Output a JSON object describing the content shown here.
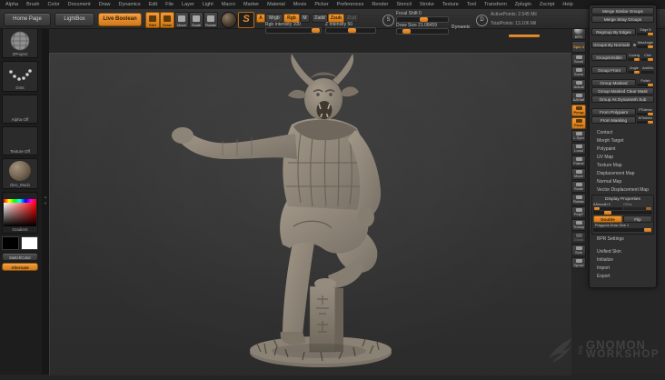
{
  "menubar": {
    "items": [
      "Alpha",
      "Brush",
      "Color",
      "Document",
      "Draw",
      "Dynamics",
      "Edit",
      "File",
      "Layer",
      "Light",
      "Macro",
      "Marker",
      "Material",
      "Movie",
      "Picker",
      "Preferences",
      "Render",
      "Stencil",
      "Stroke",
      "Texture",
      "Tool",
      "Transform",
      "Zplugin",
      "Zscript",
      "Help"
    ]
  },
  "toolbar": {
    "home_page": "Home Page",
    "lightbox": "LightBox",
    "live_boolean": "Live Boolean",
    "edit": "Edit",
    "draw": "Draw",
    "move": "Move",
    "scale": "Scale",
    "rotate": "Rotate",
    "brush_initial": "S",
    "a_badge": "A",
    "mrgb": "Mrgb",
    "rgb": "Rgb",
    "m": "M",
    "zadd": "Zadd",
    "zsub": "Zsub",
    "zcut": "Zcut",
    "rgb_intensity": "Rgb Intensity 100",
    "z_intensity": "Z Intensity 50",
    "stroke_circle": "S",
    "depth_circle": "D",
    "focal_shift": "Focal Shift 0",
    "draw_size": "Draw Size 21.08459",
    "dynamic": "Dynamic",
    "active_points": "ActivePoints: 2.545 Mil",
    "total_points": "TotalPoints: 13.106 Mil"
  },
  "left_tray": {
    "brush_label": "ZProject",
    "stroke_label": "Dots",
    "alpha_label": "Alpha Off",
    "texture_label": "Texture Off",
    "material_label": "zbro_Mud1",
    "gradient_label": "Gradient",
    "switch_color": "SwitchColor",
    "alternate": "Alternate"
  },
  "right_shelf": {
    "items": [
      "BPR",
      "Spix 3",
      "Scroll",
      "Zoom",
      "Actual",
      "AAHalf",
      "Persp",
      "Floor",
      "L.Sym",
      "Local",
      "Frame",
      "Move",
      "Scale",
      "Rotate",
      "PolyF",
      "Transp",
      "Ghost",
      "Solo",
      "Xpose"
    ]
  },
  "tool_panel": {
    "merge_similar": "Merge Similar Groups",
    "merge_stray": "Merge Stray Groups",
    "regroup_by_edges": "Regroup By Edges",
    "edge_slider": "Edge 5",
    "groups_by_normals": "Groups By Normals",
    "max_angle_slider": "MaxAngle",
    "groups_visible": "GroupsVisible",
    "coverage_slider": "Coverg",
    "cluster_slider": "Clstr",
    "group_front": "Group Front",
    "angle_slider": "Angle",
    "addvis_slider": "AddVis",
    "group_masked": "Group Masked",
    "polish_slider": "Polish",
    "group_masked_clear": "Group Masked Clear Mask",
    "group_dynamesh": "Group As Dynamesh Sub",
    "from_polypaint": "From Polypaint",
    "ptolernc_slider": "PTolernc",
    "from_masking": "From Masking",
    "mtolernc_slider": "MTolernc",
    "sections": [
      "Contact",
      "Morph Target",
      "Polypaint",
      "UV Map",
      "Texture Map",
      "Displacement Map",
      "Normal Map",
      "Vector Displacement Map"
    ],
    "display_properties": "Display Properties",
    "asmooth": "ASmooth 0",
    "ores": "ORes",
    "double_btn": "Double",
    "flip_btn": "Flip",
    "poly_draw_size": "Polygons Draw Size 1",
    "bpr_settings": "BPR Settings",
    "bottom_sections": [
      "Unified Skin",
      "Initialize",
      "Import",
      "Export"
    ]
  },
  "watermark": {
    "the": "THE",
    "name": "GNOMON",
    "type": "WORKSHOP"
  },
  "colors": {
    "accent_orange": "#e8892a",
    "clay": "#8a8177",
    "canvas_bg": "#323232"
  }
}
